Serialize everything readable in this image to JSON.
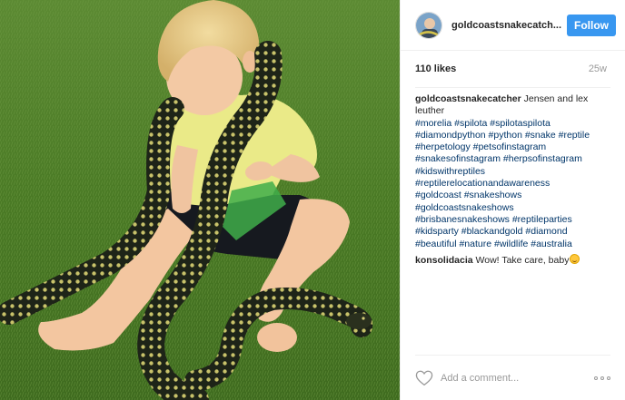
{
  "post": {
    "username": "goldcoastsnakecatch...",
    "follow_label": "Follow",
    "likes": "110 likes",
    "age": "25w",
    "caption": {
      "author": "goldcoastsnakecatcher",
      "text": "Jensen and lex leuther",
      "hashtag_lines": [
        "#morelia #spilota #spilotaspilota",
        "#diamondpython #python #snake #reptile",
        "#herpetology #petsofinstagram",
        "#snakesofinstagram #herpsofinstagram",
        "#kidswithreptiles",
        "#reptilerelocationandawareness",
        "#goldcoast #snakeshows",
        "#goldcoastsnakeshows",
        "#brisbanesnakeshows #reptileparties",
        "#kidsparty #blackandgold #diamond",
        "#beautiful #nature #wildlife #australia"
      ]
    },
    "comments": [
      {
        "author": "konsolidacia",
        "text": "Wow! Take care, baby",
        "emoji": "smiling-face-icon"
      }
    ],
    "add_comment_placeholder": "Add a comment...",
    "icons": {
      "like": "heart-icon",
      "options": "more-options-icon"
    }
  },
  "colors": {
    "follow_bg": "#3897f0",
    "hashtag": "#003569",
    "muted": "#999999",
    "grass": "#4d7a2a"
  }
}
